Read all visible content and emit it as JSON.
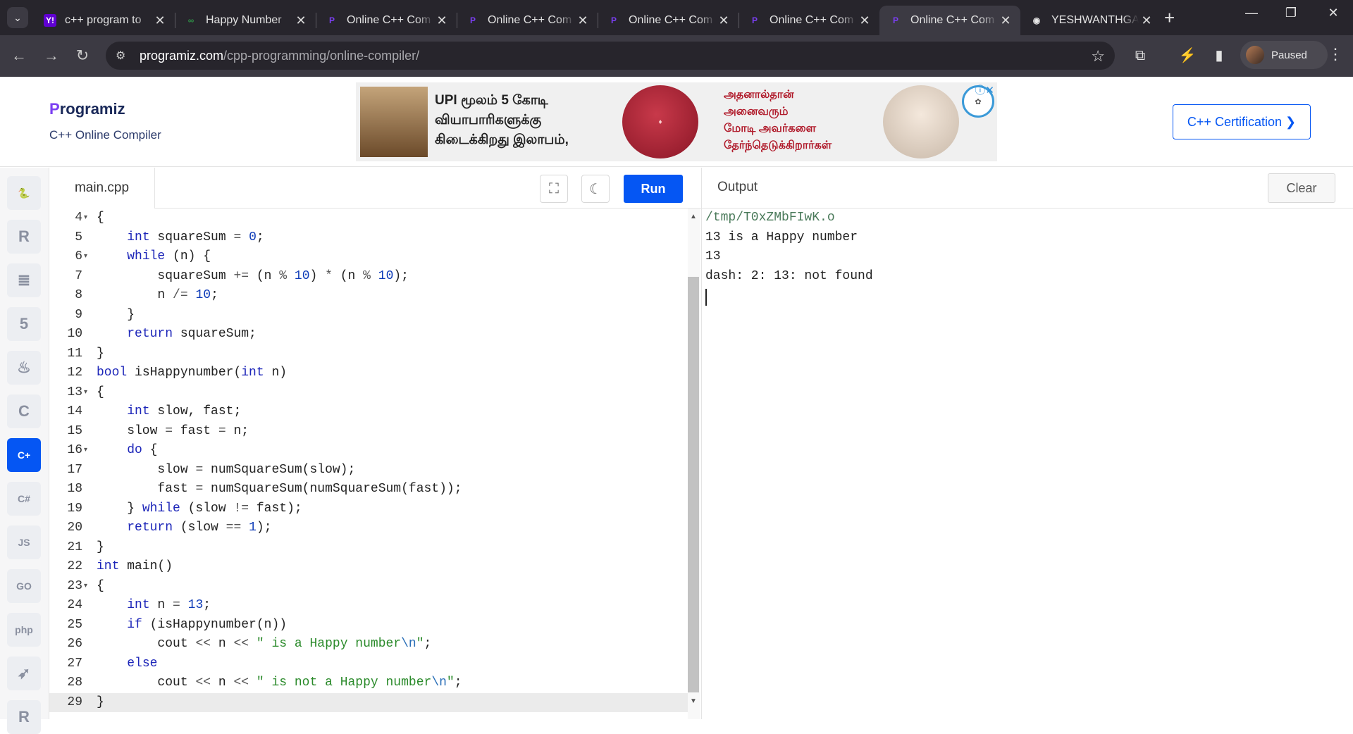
{
  "browser": {
    "tabs": [
      {
        "title": "c++ program to",
        "favicon": "yahoo-icon",
        "active": false
      },
      {
        "title": "Happy Number",
        "favicon": "gfg-icon",
        "active": false
      },
      {
        "title": "Online C++ Com",
        "favicon": "programiz-icon",
        "active": false
      },
      {
        "title": "Online C++ Com",
        "favicon": "programiz-icon",
        "active": false
      },
      {
        "title": "Online C++ Com",
        "favicon": "programiz-icon",
        "active": false
      },
      {
        "title": "Online C++ Com",
        "favicon": "programiz-icon",
        "active": false
      },
      {
        "title": "Online C++ Com",
        "favicon": "programiz-icon",
        "active": true
      },
      {
        "title": "YESHWANTHGA",
        "favicon": "github-icon",
        "active": false
      }
    ],
    "url_host": "programiz.com",
    "url_path": "/cpp-programming/online-compiler/",
    "profile_status": "Paused"
  },
  "site": {
    "logo_text": "rogramiz",
    "logo_initial": "P",
    "subtitle": "C++ Online Compiler",
    "cert_button": "C++ Certification ❯",
    "ad": {
      "line1": "UPI மூலம் 5 கோடி",
      "line2": "வியாபாரிகளுக்கு",
      "line3": "கிடைக்கிறது இலாபம்,",
      "line4": "அதனால்தான்",
      "line5": "அனைவரும்",
      "line6": "மோடி அவர்களை",
      "line7": "தேர்ந்தெடுக்கிறார்கள்"
    }
  },
  "languages": [
    {
      "name": "python",
      "glyph": "🐍"
    },
    {
      "name": "r",
      "glyph": "R"
    },
    {
      "name": "sql",
      "glyph": "≣"
    },
    {
      "name": "html",
      "glyph": "5"
    },
    {
      "name": "java",
      "glyph": "♨"
    },
    {
      "name": "c",
      "glyph": "C"
    },
    {
      "name": "cpp",
      "glyph": "C+"
    },
    {
      "name": "csharp",
      "glyph": "C#"
    },
    {
      "name": "js",
      "glyph": "JS"
    },
    {
      "name": "go",
      "glyph": "GO"
    },
    {
      "name": "php",
      "glyph": "php"
    },
    {
      "name": "swift",
      "glyph": "➶"
    },
    {
      "name": "rust",
      "glyph": "R"
    }
  ],
  "editor": {
    "filename": "main.cpp",
    "run_label": "Run",
    "lines": [
      {
        "n": "4",
        "fold": true,
        "html": "{"
      },
      {
        "n": "5",
        "fold": false,
        "html": "    <span class=kw>int</span> squareSum <span class=op>=</span> <span class=num>0</span>;"
      },
      {
        "n": "6",
        "fold": true,
        "html": "    <span class=kw>while</span> (n) {"
      },
      {
        "n": "7",
        "fold": false,
        "html": "        squareSum <span class=op>+=</span> (n <span class=op>%</span> <span class=num>10</span>) <span class=op>*</span> (n <span class=op>%</span> <span class=num>10</span>);"
      },
      {
        "n": "8",
        "fold": false,
        "html": "        n <span class=op>/=</span> <span class=num>10</span>;"
      },
      {
        "n": "9",
        "fold": false,
        "html": "    }"
      },
      {
        "n": "10",
        "fold": false,
        "html": "    <span class=kw>return</span> squareSum;"
      },
      {
        "n": "11",
        "fold": false,
        "html": "}"
      },
      {
        "n": "12",
        "fold": false,
        "html": "<span class=kw>bool</span> isHappynumber(<span class=kw>int</span> n)"
      },
      {
        "n": "13",
        "fold": true,
        "html": "{"
      },
      {
        "n": "14",
        "fold": false,
        "html": "    <span class=kw>int</span> slow, fast;"
      },
      {
        "n": "15",
        "fold": false,
        "html": "    slow <span class=op>=</span> fast <span class=op>=</span> n;"
      },
      {
        "n": "16",
        "fold": true,
        "html": "    <span class=kw>do</span> {"
      },
      {
        "n": "17",
        "fold": false,
        "html": "        slow <span class=op>=</span> numSquareSum(slow);"
      },
      {
        "n": "18",
        "fold": false,
        "html": "        fast <span class=op>=</span> numSquareSum(numSquareSum(fast));"
      },
      {
        "n": "19",
        "fold": false,
        "html": "    } <span class=kw>while</span> (slow <span class=op>!=</span> fast);"
      },
      {
        "n": "20",
        "fold": false,
        "html": "    <span class=kw>return</span> (slow <span class=op>==</span> <span class=num>1</span>);"
      },
      {
        "n": "21",
        "fold": false,
        "html": "}"
      },
      {
        "n": "22",
        "fold": false,
        "html": "<span class=kw>int</span> main()"
      },
      {
        "n": "23",
        "fold": true,
        "html": "{"
      },
      {
        "n": "24",
        "fold": false,
        "html": "    <span class=kw>int</span> n <span class=op>=</span> <span class=num>13</span>;"
      },
      {
        "n": "25",
        "fold": false,
        "html": "    <span class=kw>if</span> (isHappynumber(n))"
      },
      {
        "n": "26",
        "fold": false,
        "html": "        cout <span class=op>&lt;&lt;</span> n <span class=op>&lt;&lt;</span> <span class=str>\" is a Happy number<span class=esc>\\n</span>\"</span>;"
      },
      {
        "n": "27",
        "fold": false,
        "html": "    <span class=kw>else</span>"
      },
      {
        "n": "28",
        "fold": false,
        "html": "        cout <span class=op>&lt;&lt;</span> n <span class=op>&lt;&lt;</span> <span class=str>\" is not a Happy number<span class=esc>\\n</span>\"</span>;"
      },
      {
        "n": "29",
        "fold": false,
        "html": "}"
      }
    ]
  },
  "output": {
    "title": "Output",
    "clear_label": "Clear",
    "lines": [
      "/tmp/T0xZMbFIwK.o",
      "13 is a Happy number",
      "13",
      "dash: 2: 13: not found"
    ]
  }
}
